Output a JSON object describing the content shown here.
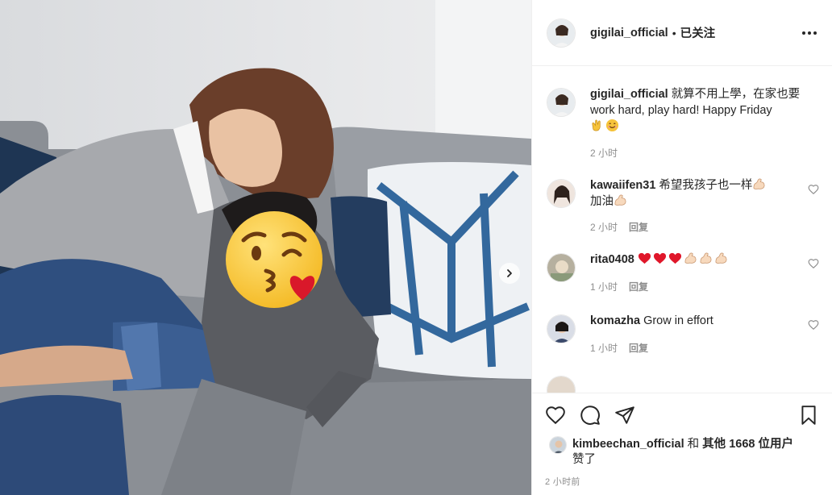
{
  "post": {
    "author": "gigilai_official",
    "separator": "•",
    "follow_label": "已关注",
    "caption": "就算不用上學，在家也要work hard, play hard! Happy Friday",
    "caption_emojis": [
      "clapping-hands",
      "smiling-face"
    ],
    "caption_time": "2 小时"
  },
  "comments": [
    {
      "user": "kawaiifen31",
      "text_before": "希望我孩子也一样",
      "text_after": "加油",
      "emojis": [
        "flexed-biceps",
        "flexed-biceps"
      ],
      "time": "2 小时",
      "reply": "回复"
    },
    {
      "user": "rita0408",
      "text": "",
      "emojis": [
        "red-heart",
        "red-heart",
        "red-heart",
        "flexed-biceps",
        "flexed-biceps",
        "flexed-biceps"
      ],
      "time": "1 小时",
      "reply": "回复"
    },
    {
      "user": "komazha",
      "text": "Grow in effort",
      "time": "1 小时",
      "reply": "回复"
    }
  ],
  "likes": {
    "first_user": "kimbeechan_official",
    "connector": "和",
    "others": "其他 1668 位用户",
    "suffix": "赞了"
  },
  "timestamp": "2 小时前",
  "icons": {
    "like": "heart-outline-icon",
    "comment": "speech-bubble-icon",
    "share": "paper-plane-icon",
    "save": "bookmark-icon",
    "more": "ellipsis-icon",
    "next": "chevron-right-icon"
  },
  "colors": {
    "text": "#262626",
    "muted": "#8e8e8e",
    "border": "#efefef"
  }
}
